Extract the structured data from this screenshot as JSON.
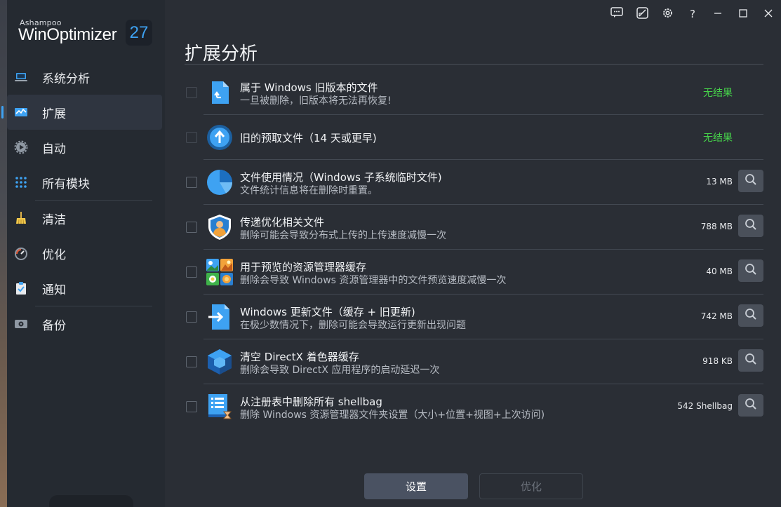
{
  "app": {
    "brand_small": "Ashampoo",
    "brand_main": "WinOptimizer",
    "version_badge": "27"
  },
  "sidebar": {
    "items": [
      {
        "label": "系统分析",
        "icon": "laptop-icon"
      },
      {
        "label": "扩展",
        "icon": "monitor-chart-icon",
        "active": true
      },
      {
        "label": "自动",
        "icon": "gear-play-icon"
      },
      {
        "label": "所有模块",
        "icon": "grid-dots-icon"
      },
      {
        "label": "清洁",
        "icon": "broom-icon"
      },
      {
        "label": "优化",
        "icon": "speedometer-icon"
      },
      {
        "label": "通知",
        "icon": "clipboard-check-icon"
      },
      {
        "label": "备份",
        "icon": "drive-icon"
      }
    ]
  },
  "titlebar": {
    "buttons": [
      "feedback-icon",
      "skin-icon",
      "settings-icon",
      "help-icon",
      "minimize-icon",
      "maximize-icon",
      "close-icon"
    ],
    "help_glyph": "?"
  },
  "page": {
    "title": "扩展分析"
  },
  "rows": [
    {
      "title": "属于 Windows 旧版本的文件",
      "desc": "一旦被删除，旧版本将无法再恢复!",
      "status": "无结果",
      "icon": "old-windows-file-icon",
      "enabled": false
    },
    {
      "title": "旧的预取文件（14 天或更早)",
      "desc": "",
      "status": "无结果",
      "icon": "prefetch-arrow-icon",
      "enabled": false
    },
    {
      "title": "文件使用情况（Windows 子系统临时文件)",
      "desc": "文件统计信息将在删除时重置。",
      "size": "13 MB",
      "icon": "pie-usage-icon",
      "enabled": true
    },
    {
      "title": "传递优化相关文件",
      "desc": "删除可能会导致分布式上传的上传速度减慢一次",
      "size": "788 MB",
      "icon": "delivery-shield-icon",
      "enabled": true
    },
    {
      "title": "用于预览的资源管理器缓存",
      "desc": "删除会导致 Windows 资源管理器中的文件预览速度减慢一次",
      "size": "40 MB",
      "icon": "thumbnail-cache-icon",
      "enabled": true
    },
    {
      "title": "Windows 更新文件（缓存 + 旧更新)",
      "desc": "在极少数情况下，删除可能会导致运行更新出现问题",
      "size": "742 MB",
      "icon": "update-file-icon",
      "enabled": true
    },
    {
      "title": "清空 DirectX 着色器缓存",
      "desc": "删除会导致 DirectX 应用程序的启动延迟一次",
      "size": "918 KB",
      "icon": "directx-cube-icon",
      "enabled": true
    },
    {
      "title": "从注册表中删除所有 shellbag",
      "desc": "删除 Windows 资源管理器文件夹设置（大小+位置+视图+上次访问)",
      "size": "542 Shellbag",
      "icon": "registry-shellbag-icon",
      "enabled": true
    }
  ],
  "footer": {
    "settings_label": "设置",
    "optimize_label": "优化"
  },
  "colors": {
    "accent": "#3ea2f2",
    "status_green": "#46d34a",
    "sidebar_bg": "#252a31",
    "main_bg": "#2a2e35"
  }
}
